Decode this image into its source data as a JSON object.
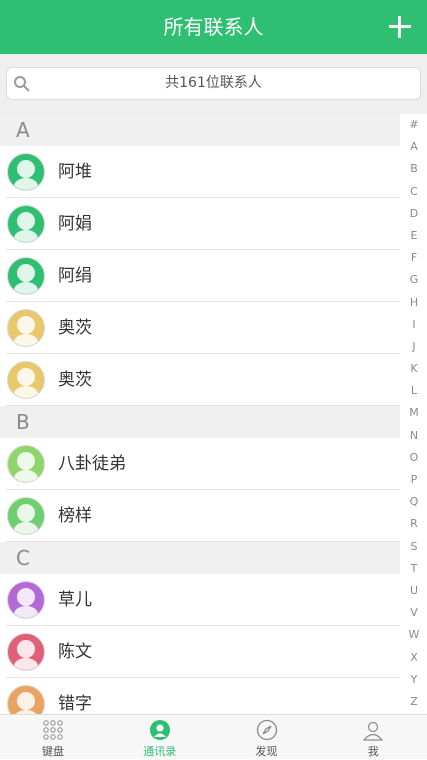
{
  "header": {
    "title": "所有联系人",
    "add_icon": "plus-icon"
  },
  "search": {
    "placeholder_text": "共161位联系人",
    "icon": "search-icon"
  },
  "sections": [
    {
      "letter": "A",
      "contacts": [
        {
          "name": "阿堆",
          "avatar_color": "#2fbf72"
        },
        {
          "name": "阿娟",
          "avatar_color": "#2fbf72"
        },
        {
          "name": "阿绢",
          "avatar_color": "#2fbf72"
        },
        {
          "name": "奥茨",
          "avatar_color": "#e8c86a"
        },
        {
          "name": "奥茨",
          "avatar_color": "#e8c86a"
        }
      ]
    },
    {
      "letter": "B",
      "contacts": [
        {
          "name": "八卦徒弟",
          "avatar_color": "#8fd66a"
        },
        {
          "name": "榜样",
          "avatar_color": "#6fcf6f"
        }
      ]
    },
    {
      "letter": "C",
      "contacts": [
        {
          "name": "草儿",
          "avatar_color": "#b36ad6"
        },
        {
          "name": "陈文",
          "avatar_color": "#e0607a"
        },
        {
          "name": "错字",
          "avatar_color": "#e8a460"
        }
      ]
    }
  ],
  "index_letters": [
    "#",
    "A",
    "B",
    "C",
    "D",
    "E",
    "F",
    "G",
    "H",
    "I",
    "J",
    "K",
    "L",
    "M",
    "N",
    "O",
    "P",
    "Q",
    "R",
    "S",
    "T",
    "U",
    "V",
    "W",
    "X",
    "Y",
    "Z"
  ],
  "tabs": [
    {
      "label": "键盘",
      "icon": "keypad-icon",
      "active": false
    },
    {
      "label": "通讯录",
      "icon": "contacts-icon",
      "active": true
    },
    {
      "label": "发现",
      "icon": "compass-icon",
      "active": false
    },
    {
      "label": "我",
      "icon": "profile-icon",
      "active": false
    }
  ],
  "colors": {
    "accent": "#2fbf72"
  }
}
